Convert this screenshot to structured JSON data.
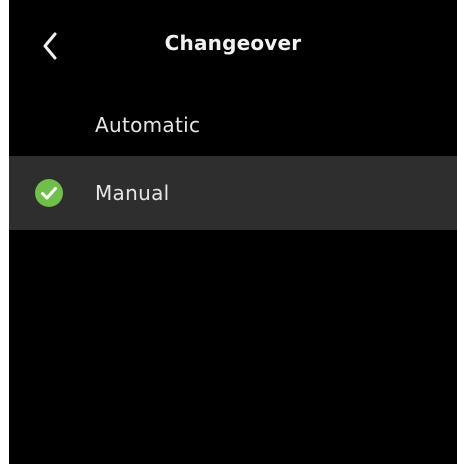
{
  "header": {
    "title": "Changeover",
    "back_icon": "chevron-left-icon"
  },
  "options": [
    {
      "label": "Automatic",
      "selected": false
    },
    {
      "label": "Manual",
      "selected": true
    }
  ],
  "colors": {
    "background": "#000000",
    "selected_row": "#2e2e2e",
    "check_green": "#6fbf4a",
    "text": "#e6e6e6"
  }
}
